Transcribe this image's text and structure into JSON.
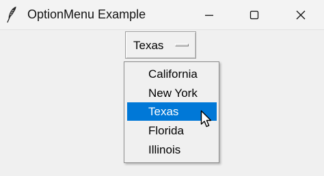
{
  "window": {
    "title": "OptionMenu Example",
    "app_icon": "feather-icon",
    "controls": {
      "minimize_icon": "minimize-icon",
      "maximize_icon": "maximize-icon",
      "close_icon": "close-icon"
    }
  },
  "option_menu": {
    "selected_value": "Texas",
    "indicator_icon": "option-indicator-icon",
    "options": [
      "California",
      "New York",
      "Texas",
      "Florida",
      "Illinois"
    ],
    "highlighted_index": 2
  },
  "colors": {
    "highlight": "#0078d7",
    "background": "#f0f0f0",
    "titlebar": "#f3f3f3"
  }
}
